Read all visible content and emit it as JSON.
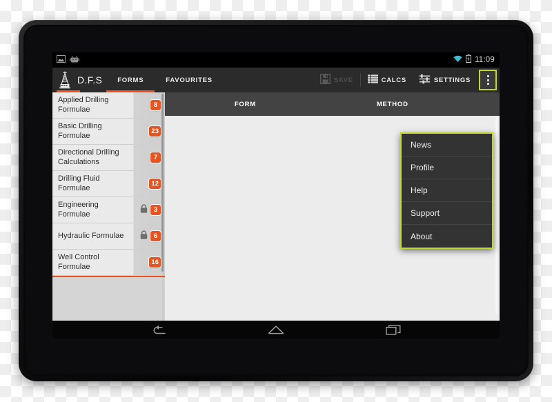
{
  "device": {
    "name": "android-tablet",
    "camera_name": "front-camera"
  },
  "status_bar": {
    "notification_icons": [
      "image-notification-icon",
      "android-robot-notification-icon"
    ],
    "wifi_icon": "wifi-icon",
    "battery_icon": "battery-icon",
    "clock": "11:09",
    "wifi_color": "#3fb8d4"
  },
  "action_bar": {
    "app_name": "D.F.S",
    "logo_icon": "drilling-rig-logo-icon",
    "accent_color": "#f4511e",
    "tabs": [
      {
        "label": "FORMS",
        "active": true
      },
      {
        "label": "FAVOURITES",
        "active": false
      }
    ],
    "actions": [
      {
        "label": "SAVE",
        "icon": "floppy-disk-save-icon",
        "disabled": true
      },
      {
        "label": "CALCS",
        "icon": "list-lines-calcs-icon",
        "disabled": false
      },
      {
        "label": "SETTINGS",
        "icon": "sliders-settings-icon",
        "disabled": false
      }
    ],
    "overflow_icon": "overflow-dots-icon",
    "highlight_color": "#c4d72e"
  },
  "sidebar": {
    "badge_color": "#e8541f",
    "items": [
      {
        "label": "Applied Drilling Formulae",
        "count": "8",
        "locked": false
      },
      {
        "label": "Basic Drilling Formulae",
        "count": "23",
        "locked": false
      },
      {
        "label": "Directional Drilling Calculations",
        "count": "7",
        "locked": false
      },
      {
        "label": "Drilling Fluid Formulae",
        "count": "12",
        "locked": false
      },
      {
        "label": "Engineering Formulae",
        "count": "3",
        "locked": true
      },
      {
        "label": "Hydraulic Formulae",
        "count": "6",
        "locked": true
      },
      {
        "label": "Well Control Formulae",
        "count": "16",
        "locked": false
      }
    ],
    "lock_icon": "lock-icon"
  },
  "content": {
    "columns": [
      {
        "label": "FORM"
      },
      {
        "label": "METHOD"
      }
    ],
    "rows": []
  },
  "overflow_menu": {
    "open": true,
    "items": [
      {
        "label": "News"
      },
      {
        "label": "Profile"
      },
      {
        "label": "Help"
      },
      {
        "label": "Support"
      },
      {
        "label": "About"
      }
    ]
  },
  "nav_bar": {
    "buttons": [
      {
        "icon": "back-arrow-icon"
      },
      {
        "icon": "home-icon"
      },
      {
        "icon": "recent-apps-icon"
      }
    ]
  }
}
